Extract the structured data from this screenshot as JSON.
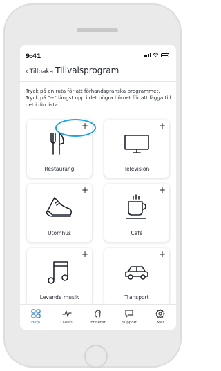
{
  "status_bar": {
    "time": "9:41"
  },
  "header": {
    "back_label": "Tillbaka",
    "title": "Tillvalsprogram"
  },
  "intro_text": "Tryck på en ruta för att förhandsgranska programmet. Tryck på \"+\" längst upp i det högra hörnet för att lägga till det i din lista.",
  "tiles": [
    {
      "label": "Restaurang",
      "icon": "utensils-icon",
      "add": "+"
    },
    {
      "label": "Television",
      "icon": "tv-icon",
      "add": "+"
    },
    {
      "label": "Utomhus",
      "icon": "shoe-icon",
      "add": "+"
    },
    {
      "label": "Café",
      "icon": "coffee-cup-icon",
      "add": "+"
    },
    {
      "label": "Levande musik",
      "icon": "music-note-icon",
      "add": "+"
    },
    {
      "label": "Transport",
      "icon": "car-icon",
      "add": "+"
    },
    {
      "label": "",
      "icon": "",
      "add": "+"
    }
  ],
  "bottom_nav": [
    {
      "label": "Hem",
      "icon": "home-grid-icon",
      "active": true
    },
    {
      "label": "Livsstil",
      "icon": "activity-icon",
      "active": false
    },
    {
      "label": "Enheter",
      "icon": "hearing-aid-icon",
      "active": false
    },
    {
      "label": "Support",
      "icon": "chat-bubble-icon",
      "active": false
    },
    {
      "label": "Mer",
      "icon": "gear-icon",
      "active": false
    }
  ],
  "colors": {
    "accent": "#2f7dd1",
    "highlight": "#1aa3e8",
    "frame": "#eaeaea"
  }
}
